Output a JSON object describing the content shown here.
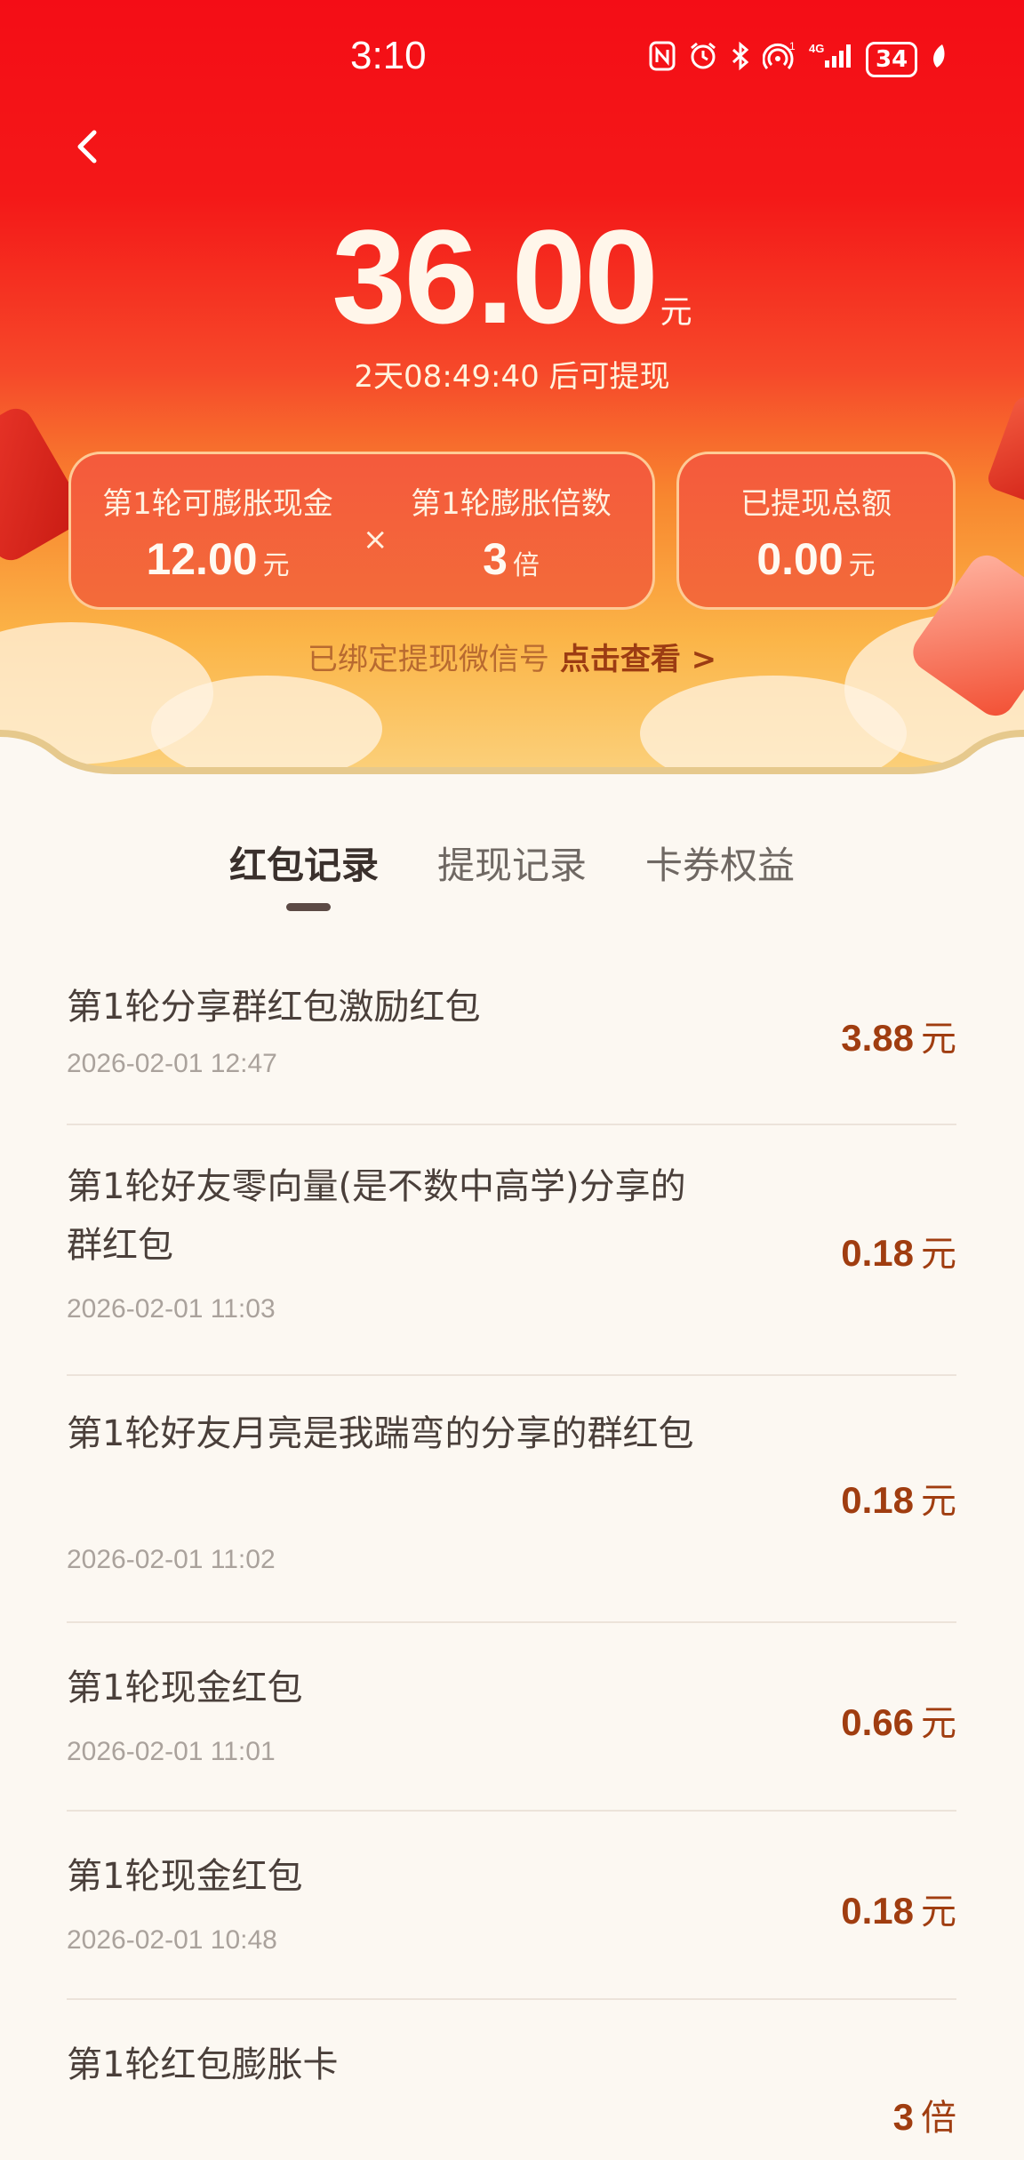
{
  "status_bar": {
    "time": "3:10",
    "icons": [
      "nfc-icon",
      "alarm-icon",
      "bluetooth-icon",
      "hotspot-icon",
      "signal-4g-icon"
    ],
    "battery": "34"
  },
  "header": {
    "amount": "36.00",
    "amount_unit": "元",
    "countdown": "2天08:49:40 后可提现"
  },
  "stats": {
    "cash_label": "第1轮可膨胀现金",
    "cash_value": "12.00",
    "cash_unit": "元",
    "times_symbol": "×",
    "multiplier_label": "第1轮膨胀倍数",
    "multiplier_value": "3",
    "multiplier_unit": "倍",
    "withdrawn_label": "已提现总额",
    "withdrawn_value": "0.00",
    "withdrawn_unit": "元"
  },
  "bind": {
    "text": "已绑定提现微信号",
    "link": "点击查看 >"
  },
  "tabs": [
    {
      "label": "红包记录",
      "active": true
    },
    {
      "label": "提现记录",
      "active": false
    },
    {
      "label": "卡券权益",
      "active": false
    }
  ],
  "records": [
    {
      "title": "第1轮分享群红包激励红包",
      "date": "2026-02-01 12:47",
      "amount": "3.88",
      "unit": "元"
    },
    {
      "title": "第1轮好友零向量(是不数中高学)分享的群红包",
      "date": "2026-02-01 11:03",
      "amount": "0.18",
      "unit": "元"
    },
    {
      "title": "第1轮好友月亮是我踹弯的分享的群红包",
      "date": "2026-02-01 11:02",
      "amount": "0.18",
      "unit": "元"
    },
    {
      "title": "第1轮现金红包",
      "date": "2026-02-01 11:01",
      "amount": "0.66",
      "unit": "元"
    },
    {
      "title": "第1轮现金红包",
      "date": "2026-02-01 10:48",
      "amount": "0.18",
      "unit": "元"
    },
    {
      "title": "第1轮红包膨胀卡",
      "date": "",
      "amount": "3",
      "unit": "倍"
    }
  ],
  "colors": {
    "header_red": "#f40d16",
    "amount_text": "#a03d10",
    "page_background": "#fcf8f2"
  }
}
